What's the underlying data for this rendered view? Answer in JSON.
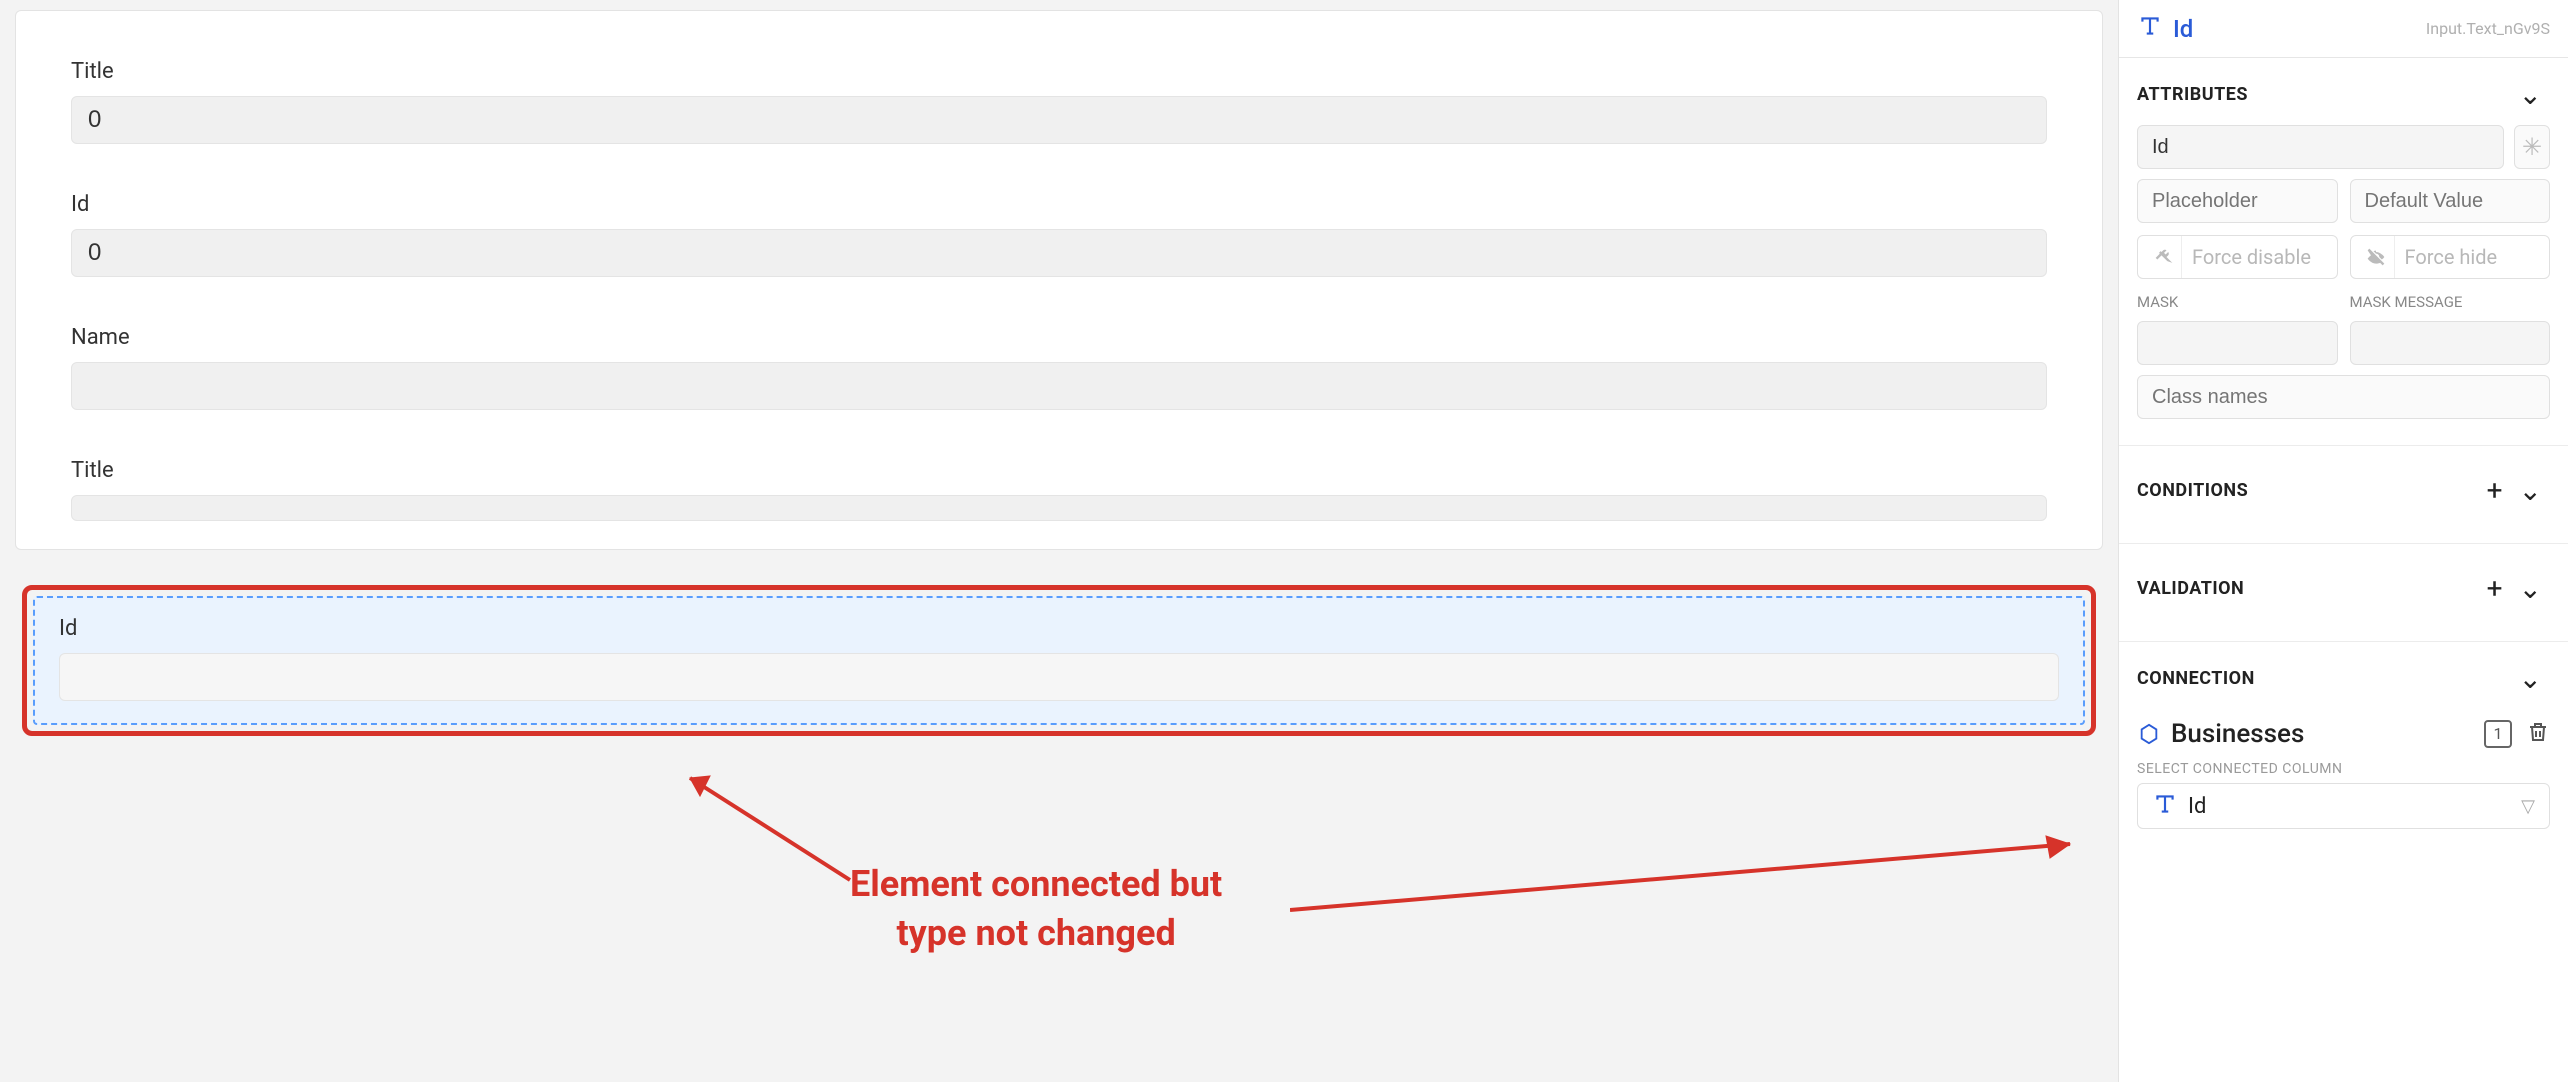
{
  "form": {
    "fields": [
      {
        "label": "Title",
        "value": "0"
      },
      {
        "label": "Id",
        "value": "0"
      },
      {
        "label": "Name",
        "value": ""
      },
      {
        "label": "Title",
        "value": ""
      },
      {
        "label": "Id",
        "value": ""
      }
    ]
  },
  "annotation": {
    "text_line1": "Element connected but",
    "text_line2": "type not changed"
  },
  "panel": {
    "header": {
      "title": "Id",
      "element_id": "Input.Text_nGv9S"
    },
    "attributes": {
      "title": "ATTRIBUTES",
      "label_value": "Id",
      "placeholder_placeholder": "Placeholder",
      "default_value_placeholder": "Default Value",
      "force_disable_label": "Force disable",
      "force_hide_label": "Force hide",
      "mask_label": "MASK",
      "mask_message_label": "MASK MESSAGE",
      "class_names_placeholder": "Class names"
    },
    "conditions": {
      "title": "CONDITIONS"
    },
    "validation": {
      "title": "VALIDATION"
    },
    "connection": {
      "title": "CONNECTION",
      "entity": "Businesses",
      "select_label": "SELECT CONNECTED COLUMN",
      "selected_column": "Id",
      "index_badge": "1"
    }
  }
}
